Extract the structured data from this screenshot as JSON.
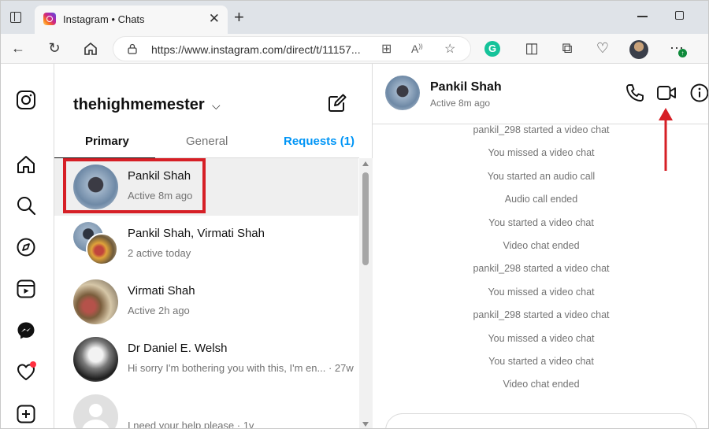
{
  "browser": {
    "tab_title": "Instagram • Chats",
    "url": "https://www.instagram.com/direct/t/11157..."
  },
  "sidebar": {
    "notification_color": "#ff3040"
  },
  "inbox": {
    "username": "thehighmemester",
    "tabs": {
      "primary": "Primary",
      "general": "General",
      "requests": "Requests (1)"
    },
    "chats": [
      {
        "name": "Pankil Shah",
        "sub": "Active 8m ago",
        "selected": true
      },
      {
        "name": "Pankil Shah, Virmati Shah",
        "sub": "2 active today"
      },
      {
        "name": "Virmati Shah",
        "sub": "Active 2h ago"
      },
      {
        "name": "Dr Daniel E. Welsh",
        "sub": "Hi sorry I'm bothering you with this, I'm en... · 27w"
      },
      {
        "name": "",
        "sub": "I need your help please · 1y"
      }
    ]
  },
  "thread": {
    "name": "Pankil Shah",
    "status": "Active 8m ago",
    "messages": [
      "pankil_298 started a video chat",
      "You missed a video chat",
      "You started an audio call",
      "Audio call ended",
      "You started a video chat",
      "Video chat ended",
      "pankil_298 started a video chat",
      "You missed a video chat",
      "pankil_298 started a video chat",
      "You missed a video chat",
      "You started a video chat",
      "Video chat ended"
    ]
  },
  "colors": {
    "accent_blue": "#0095f6",
    "highlight_red": "#d61f26"
  }
}
